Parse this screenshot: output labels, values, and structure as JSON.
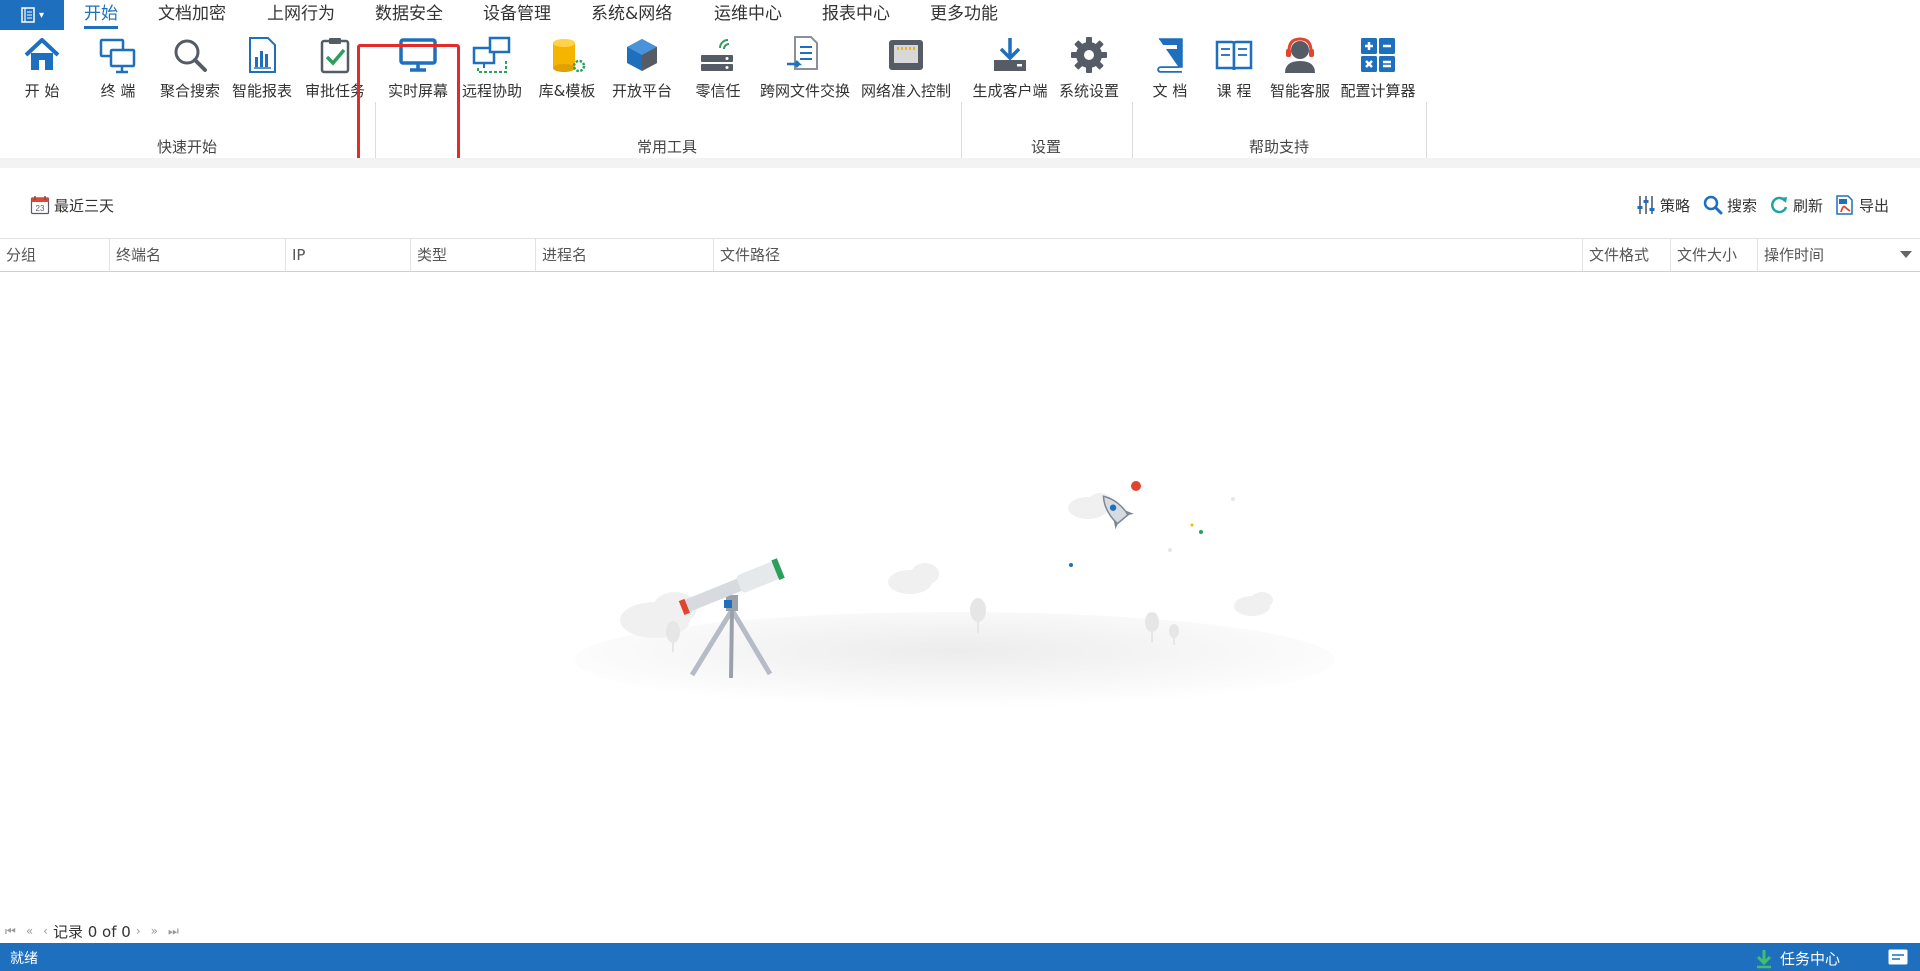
{
  "menu": {
    "tabs": [
      "开始",
      "文档加密",
      "上网行为",
      "数据安全",
      "设备管理",
      "系统&网络",
      "运维中心",
      "报表中心",
      "更多功能"
    ],
    "active_index": 0
  },
  "ribbon": {
    "buttons": [
      "开 始",
      "终 端",
      "聚合搜索",
      "智能报表",
      "审批任务",
      "实时屏幕",
      "远程协助",
      "库&模板",
      "开放平台",
      "零信任",
      "跨网文件交换",
      "网络准入控制",
      "生成客户端",
      "系统设置",
      "文 档",
      "课 程",
      "智能客服",
      "配置计算器"
    ],
    "groups": [
      "快速开始",
      "常用工具",
      "设置",
      "帮助支持"
    ]
  },
  "toolbar": {
    "date_range": "最近三天",
    "calendar_day": "23",
    "strategy": "策略",
    "search": "搜索",
    "refresh": "刷新",
    "export": "导出"
  },
  "grid": {
    "columns": [
      "分组",
      "终端名",
      "IP",
      "类型",
      "进程名",
      "文件路径",
      "文件格式",
      "文件大小",
      "操作时间"
    ]
  },
  "pager": {
    "record_text": "记录 0 of 0"
  },
  "statusbar": {
    "status": "就绪",
    "task_center": "任务中心"
  },
  "colors": {
    "accent": "#1e6fbe",
    "highlight": "#e52a2a",
    "statusbar": "#1e6fbe"
  }
}
